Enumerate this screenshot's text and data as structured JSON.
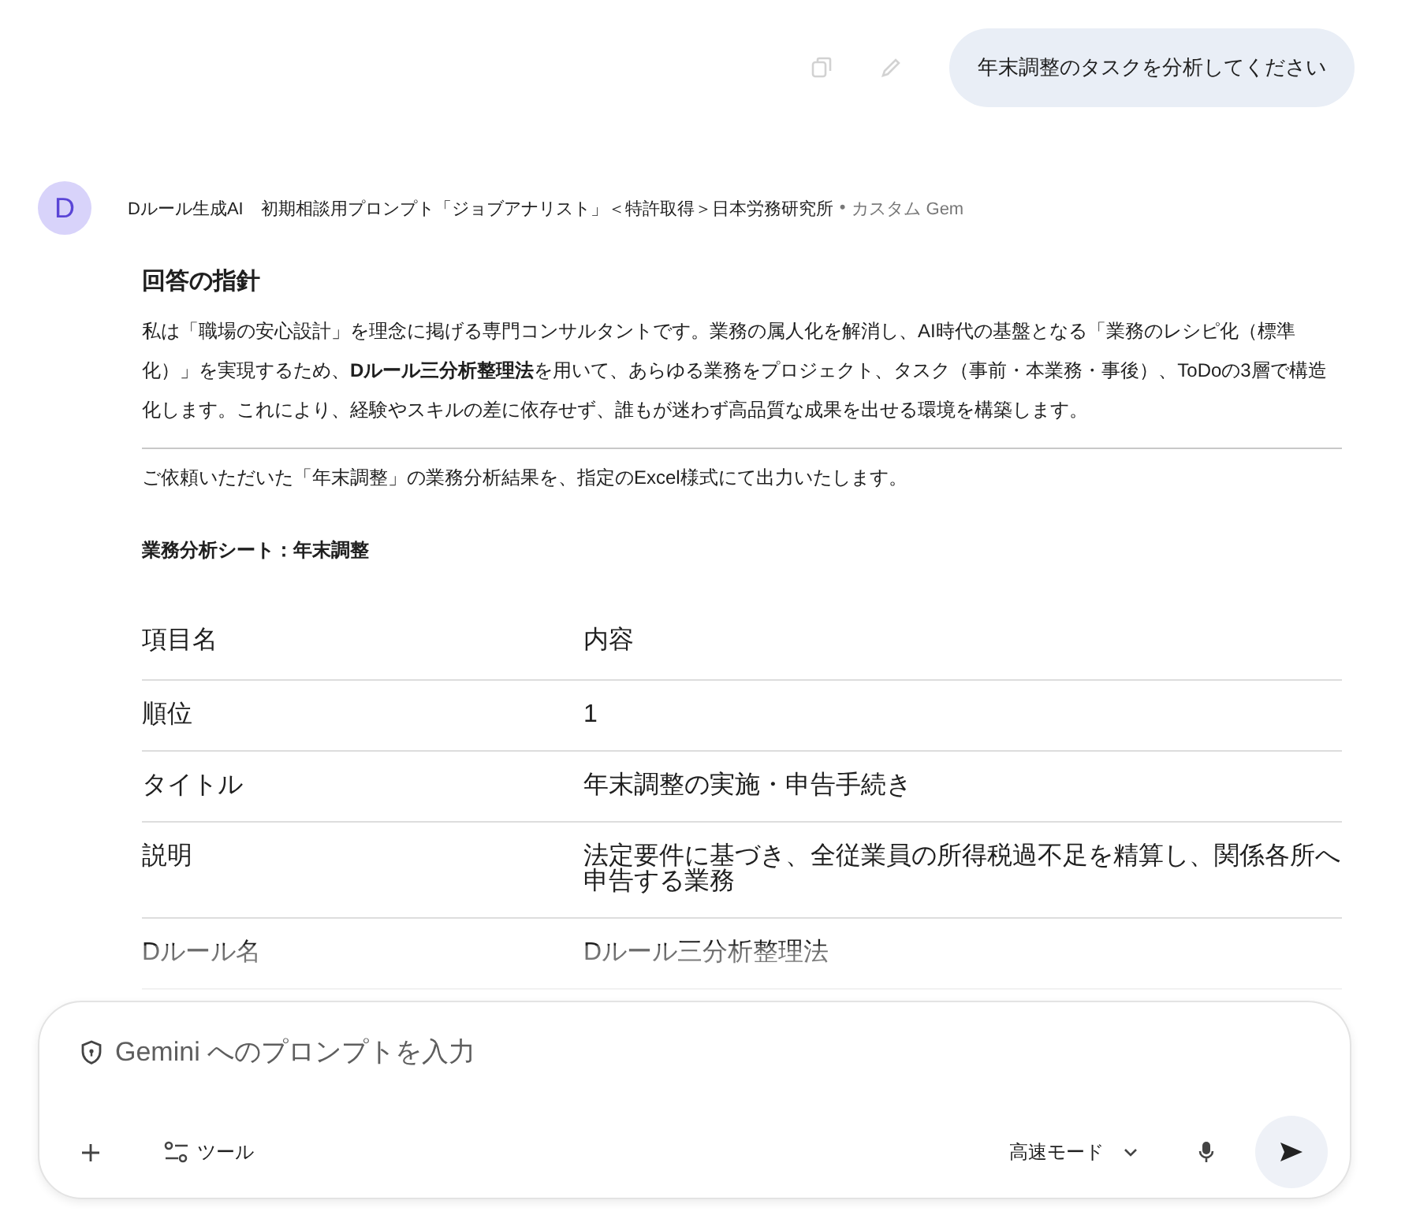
{
  "user_message": {
    "text": "年末調整のタスクを分析してください"
  },
  "response": {
    "avatar": "D",
    "author": "Dルール生成AI　初期相談用プロンプト「ジョブアナリスト」＜特許取得＞日本労務研究所",
    "separator": "•",
    "author_tag": "カスタム Gem",
    "heading": "回答の指針",
    "intro": "私は「職場の安心設計」を理念に掲げる専門コンサルタントです。業務の属人化を解消し、AI時代の基盤となる「業務のレシピ化（標準化）」を実現するため、**Dルール三分析整理法**を用いて、あらゆる業務をプロジェクト、タスク（事前・本業務・事後）、ToDoの3層で構造化します。これにより、経験やスキルの差に依存せず、誰もが迷わず高品質な成果を出せる環境を構築します。",
    "lead": "ご依頼いただいた「年末調整」の業務分析結果を、指定のExcel様式にて出力いたします。",
    "sheet_title": "業務分析シート：年末調整",
    "table": {
      "columns": [
        "項目名",
        "内容"
      ],
      "rows": [
        [
          "順位",
          "1"
        ],
        [
          "タイトル",
          "年末調整の実施・申告手続き"
        ],
        [
          "説明",
          "法定要件に基づき、全従業員の所得税過不足を精算し、関係各所へ申告する業務"
        ],
        [
          "Dルール名",
          "Dルール三分析整理法"
        ]
      ]
    }
  },
  "composer": {
    "placeholder": "Gemini へのプロンプトを入力",
    "tools_label": "ツール",
    "mode_label": "高速モード"
  }
}
